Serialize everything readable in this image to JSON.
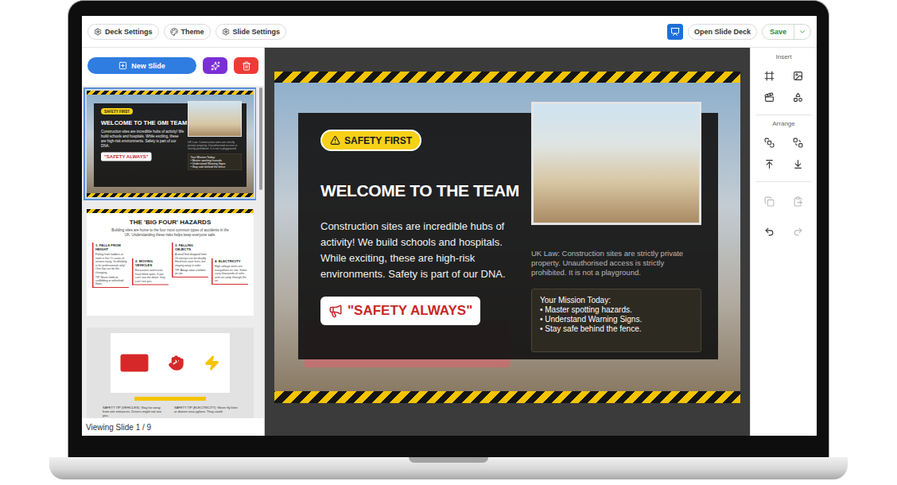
{
  "toolbar": {
    "left_buttons": [
      {
        "label": "Deck Settings"
      },
      {
        "label": "Theme"
      },
      {
        "label": "Slide Settings"
      }
    ],
    "present_button": {
      "selected": true
    },
    "open_button": "Open Slide Deck",
    "save_button": "Save"
  },
  "sidebar": {
    "new_slide": "New Slide",
    "scrollbar": {
      "level": 0.31
    },
    "status": "Viewing Slide 1 / 9",
    "thumbnails": [
      {
        "kind": "welcome",
        "selected": true,
        "badge": "SAFETY FIRST",
        "title": "WELCOME TO THE GMI TEAM",
        "body": "Construction sites are incredible hubs of activity! We build schools and hospitals. While exciting, these are high-risk environments. Safety is part of our DNA.",
        "cta": "\"SAFETY ALWAYS\"",
        "note": "UK Law: Construction sites are strictly private property. Unauthorised access is strictly prohibited. It is not a playground.",
        "mission": {
          "title": "Your Mission Today:",
          "items": [
            "• Master spotting hazards",
            "• Understand Warning Signs",
            "• Stay safe behind the fence"
          ]
        }
      },
      {
        "kind": "hazards",
        "selected": false,
        "title": "THE 'BIG FOUR' HAZARDS",
        "intro": "Building sites are home to the four most common types of accidents in the UK. Understanding these risks helps keep everyone safe.",
        "cards": [
          {
            "title": "1. FALLS FROM HEIGHT",
            "body": "Falling from ladders or roofs is the #1 cause of serious injury. Scaffolding is for professionals only! One slip can be life-changing.",
            "tip": "TIP: Never climb on scaffolding or unfinished floors."
          },
          {
            "title": "2. MOVING VEHICLES",
            "body": "Excavators and trucks have blind spots. If you can't see the driver, they can't see you."
          },
          {
            "title": "3. FALLING OBJECTS",
            "body": "A small bolt dropped from 20 storeys can be deadly. Hard hats save lives, but staying away is safer.",
            "tip": "TIP: Always wear a helmet on site."
          },
          {
            "title": "4. ELECTRICITY",
            "body": "High voltage wires are everywhere on site. Some carry thousands of volts and can jump through the air."
          }
        ]
      },
      {
        "kind": "tips",
        "selected": false,
        "tips": [
          "SAFETY TIP (VEHICLES): Stay far away from site entrances. Drivers might not see you.",
          "SAFETY TIP (ELECTRICITY): Never fly kites or drones near pylons. They could"
        ]
      }
    ]
  },
  "slide": {
    "badge": "SAFETY FIRST",
    "title": "WELCOME TO THE TEAM",
    "body": "Construction sites are incredible hubs of activity! We build schools and hospitals. While exciting, these are high-risk environments. Safety is part of our DNA.",
    "cta": "\"SAFETY ALWAYS\"",
    "note": "UK Law: Construction sites are strictly private property. Unauthorised access is strictly prohibited. It is not a playground.",
    "mission": {
      "title": "Your Mission Today:",
      "items": [
        "• Master spotting hazards.",
        "• Understand Warning Signs.",
        "• Stay safe behind the fence."
      ]
    }
  },
  "inspector": {
    "insert": {
      "title": "Insert",
      "tools": [
        {
          "disabled": false
        },
        {
          "disabled": false
        },
        {
          "disabled": false
        },
        {
          "disabled": false
        }
      ]
    },
    "arrange": {
      "title": "Arrange",
      "tools": [
        {
          "disabled": false
        },
        {
          "disabled": false
        },
        {
          "disabled": false
        },
        {
          "disabled": false
        }
      ]
    },
    "clipboard": [
      {
        "disabled": true
      },
      {
        "disabled": true
      }
    ],
    "history": [
      {
        "disabled": false
      },
      {
        "disabled": true
      }
    ]
  }
}
